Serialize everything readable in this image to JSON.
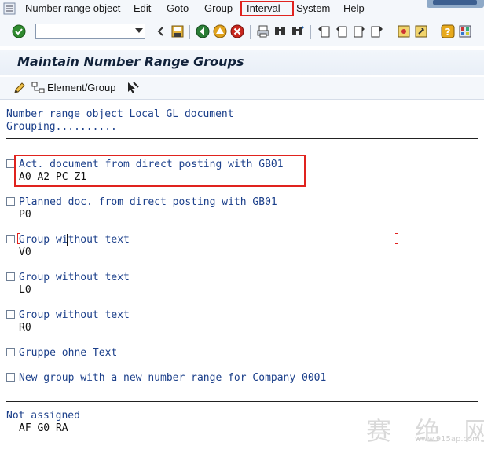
{
  "menu": {
    "items": [
      {
        "label": "Number range object"
      },
      {
        "label": "Edit"
      },
      {
        "label": "Goto"
      },
      {
        "label": "Group"
      },
      {
        "label": "Interval"
      },
      {
        "label": "System"
      },
      {
        "label": "Help"
      }
    ]
  },
  "toolbar": {
    "command_field_value": "",
    "icons": [
      "enter-icon",
      "save-icon",
      "back-icon",
      "exit-icon",
      "cancel-icon",
      "print-icon",
      "find-icon",
      "find-next-icon",
      "first-page-icon",
      "previous-page-icon",
      "next-page-icon",
      "last-page-icon",
      "new-session-icon",
      "shortcut-icon",
      "help-icon",
      "customize-layout-icon"
    ]
  },
  "page": {
    "title": "Maintain Number Range Groups"
  },
  "app_toolbar": {
    "element_group_label": "Element/Group"
  },
  "content": {
    "object_line": "Number range object Local GL document",
    "grouping_line": "Grouping..........",
    "groups": [
      {
        "name": "Act. document from direct posting with GB01",
        "elements": "A0 A2 PC Z1"
      },
      {
        "name": "Planned doc. from direct posting with GB01",
        "elements": "P0"
      },
      {
        "name": "Group without text",
        "elements": "V0"
      },
      {
        "name": "Group without text",
        "elements": "L0"
      },
      {
        "name": "Group without text",
        "elements": "R0"
      },
      {
        "name": "Gruppe ohne Text",
        "elements": ""
      },
      {
        "name": "New group with a new number range for Company 0001",
        "elements": ""
      }
    ],
    "not_assigned_label": "Not assigned",
    "not_assigned_elements": "AF G0 RA"
  },
  "watermark": {
    "text": "赛 绝 网",
    "url": "www.915ap.com"
  }
}
